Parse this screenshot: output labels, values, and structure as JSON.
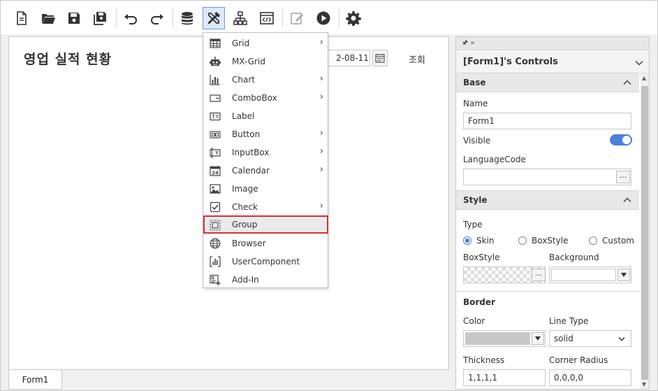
{
  "toolbar": {
    "buttons": [
      "new-document",
      "open-folder",
      "save",
      "save-all",
      "undo",
      "redo",
      "database",
      "tools",
      "hierarchy",
      "code-view",
      "edit",
      "run",
      "settings"
    ],
    "active": "tools"
  },
  "canvas": {
    "form_title": "영업 실적 현황",
    "date_value": "2-08-11",
    "query_label": "조회"
  },
  "bottom_tabs": [
    {
      "label": "Form1"
    }
  ],
  "menu": {
    "items": [
      {
        "label": "Grid",
        "icon": "grid-icon",
        "submenu": true
      },
      {
        "label": "MX-Grid",
        "icon": "robot-icon",
        "submenu": false
      },
      {
        "label": "Chart",
        "icon": "chart-icon",
        "submenu": true
      },
      {
        "label": "ComboBox",
        "icon": "combobox-icon",
        "submenu": true
      },
      {
        "label": "Label",
        "icon": "label-icon",
        "submenu": false
      },
      {
        "label": "Button",
        "icon": "button-icon",
        "submenu": true
      },
      {
        "label": "InputBox",
        "icon": "inputbox-icon",
        "submenu": true
      },
      {
        "label": "Calendar",
        "icon": "calendar-icon",
        "submenu": true
      },
      {
        "label": "Image",
        "icon": "image-icon",
        "submenu": false
      },
      {
        "label": "Check",
        "icon": "check-icon",
        "submenu": true
      },
      {
        "label": "Group",
        "icon": "group-icon",
        "submenu": false,
        "selected": true
      },
      {
        "label": "Browser",
        "icon": "globe-icon",
        "submenu": false
      },
      {
        "label": "UserComponent",
        "icon": "usercomponent-icon",
        "submenu": false
      },
      {
        "label": "Add-In",
        "icon": "addin-icon",
        "submenu": false
      }
    ],
    "submenu_arrow": "›"
  },
  "panel": {
    "pin_glyphs": "🖈 »",
    "header": "[Form1]'s Controls",
    "base": {
      "title": "Base",
      "name_label": "Name",
      "name_value": "Form1",
      "visible_label": "Visible",
      "visible_on": true,
      "language_label": "LanguageCode",
      "language_value": "",
      "dots": "..."
    },
    "style": {
      "title": "Style",
      "type_label": "Type",
      "type_options": [
        "Skin",
        "BoxStyle",
        "Custom"
      ],
      "type_selected": "Skin",
      "boxstyle_label": "BoxStyle",
      "background_label": "Background",
      "dots": "..."
    },
    "border": {
      "title": "Border",
      "color_label": "Color",
      "linetype_label": "Line Type",
      "linetype_value": "solid",
      "thickness_label": "Thickness",
      "thickness_value": "1,1,1,1",
      "corner_label": "Corner Radius",
      "corner_value": "0,0,0,0"
    }
  },
  "colors": {
    "accent": "#4a7fe0",
    "selected_outline": "#d6303c",
    "active_tool_bg": "#dbe9f7"
  }
}
